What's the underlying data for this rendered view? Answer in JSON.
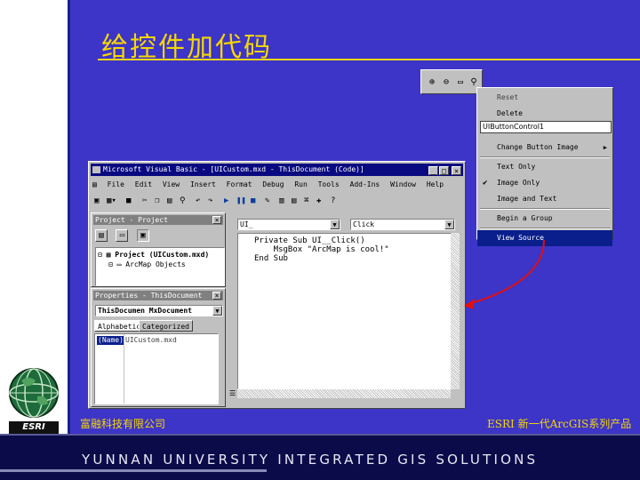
{
  "slide": {
    "title": "给控件加代码",
    "footer_left": "富融科技有限公司",
    "footer_right": "ESRI 新一代ArcGIS系列产品",
    "bottom_banner": "YUNNAN UNIVERSITY INTEGRATED GIS SOLUTIONS",
    "logo_text": "ESRI",
    "accent_color": "#f5d700",
    "background_color": "#3d34c8"
  },
  "mini_toolbar": {
    "icons": [
      "zoom-in-icon",
      "zoom-out-icon",
      "full-extent-icon",
      "identify-icon"
    ]
  },
  "context_menu": {
    "items": [
      {
        "label": "Reset",
        "disabled": true
      },
      {
        "label": "Delete",
        "disabled": false
      },
      {
        "label": "UIButtonControl1",
        "is_name_box": true
      },
      {
        "label": "Change Button Image",
        "has_submenu": true
      },
      {
        "label": "Text Only",
        "disabled": false
      },
      {
        "label": "Image Only",
        "checked": true
      },
      {
        "label": "Image and Text",
        "disabled": false
      },
      {
        "label": "Begin a Group",
        "disabled": false
      },
      {
        "label": "View Source",
        "selected": true
      }
    ]
  },
  "vb_window": {
    "title": "Microsoft Visual Basic - [UICustom.mxd - ThisDocument (Code)]",
    "menu": [
      "File",
      "Edit",
      "View",
      "Insert",
      "Format",
      "Debug",
      "Run",
      "Tools",
      "Add-Ins",
      "Window",
      "Help"
    ],
    "project_pane": {
      "title": "Project - Project",
      "tree": [
        "Project (UICustom.mxd)",
        "ArcMap Objects"
      ]
    },
    "properties_pane": {
      "title": "Properties - ThisDocument",
      "object_combo": "ThisDocumen MxDocument",
      "tabs": [
        "Alphabetic",
        "Categorized"
      ],
      "rows": [
        {
          "name": "(Name)",
          "value": "UICustom.mxd"
        }
      ]
    },
    "code_pane": {
      "object_combo": "UI_",
      "procedure_combo": "Click",
      "lines": [
        "Private Sub UI__Click()",
        "    MsgBox \"ArcMap is cool!\"",
        "End Sub"
      ]
    }
  }
}
